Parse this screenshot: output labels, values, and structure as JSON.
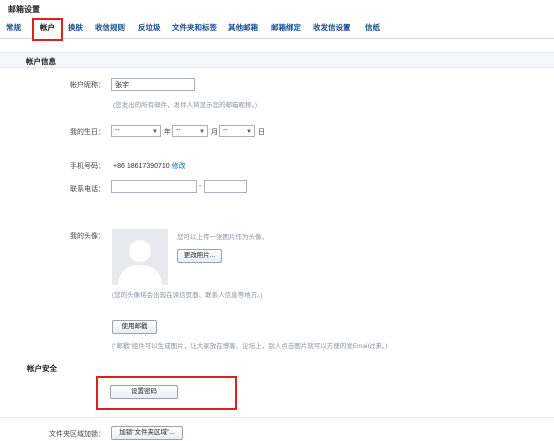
{
  "header": {
    "title": "邮箱设置"
  },
  "tabs": [
    {
      "label": "常规"
    },
    {
      "label": "帐户"
    },
    {
      "label": "换肤"
    },
    {
      "label": "收信规则"
    },
    {
      "label": "反垃圾"
    },
    {
      "label": "文件夹和标签"
    },
    {
      "label": "其他邮箱"
    },
    {
      "label": "邮箱绑定"
    },
    {
      "label": "收发信设置"
    },
    {
      "label": "信纸"
    }
  ],
  "account_info": {
    "section_title": "帐户信息",
    "nickname": {
      "label": "帐户昵称：",
      "value": "张宇",
      "hint": "(您发出的所有邮件，发件人将显示您的邮箱昵称。)"
    },
    "birthday": {
      "label": "我的生日：",
      "year_value": "--",
      "year_unit": "年",
      "month_value": "--",
      "month_unit": "月",
      "day_value": "--",
      "day_unit": "日"
    },
    "mobile": {
      "label": "手机号码：",
      "value": "+86 18617390710",
      "modify_link": "修改"
    },
    "phone": {
      "label": "联系电话：",
      "separator": "-"
    },
    "avatar": {
      "label": "我的头像：",
      "upload_hint": "您可以上传一张图片作为头像。",
      "change_button": "更改照片...",
      "display_hint": "(您的头像将会出现在读信页面、联系人信息等地方。)"
    },
    "card": {
      "button": "使用邮戳",
      "hint": "(\"邮戳\"组件可以生成图片，让大家放在博客、论坛上，别人点击图片就可以方便的发Email过来。)"
    }
  },
  "account_security": {
    "section_title": "帐户安全",
    "password_button": "设置密码"
  },
  "folder_lock": {
    "label": "文件夹区域加锁：",
    "button": "加锁\"文件夹区域\"..."
  },
  "colors": {
    "accent": "#1a4d8f",
    "highlight": "#e02020",
    "section_bg": "#f4f6f9"
  }
}
